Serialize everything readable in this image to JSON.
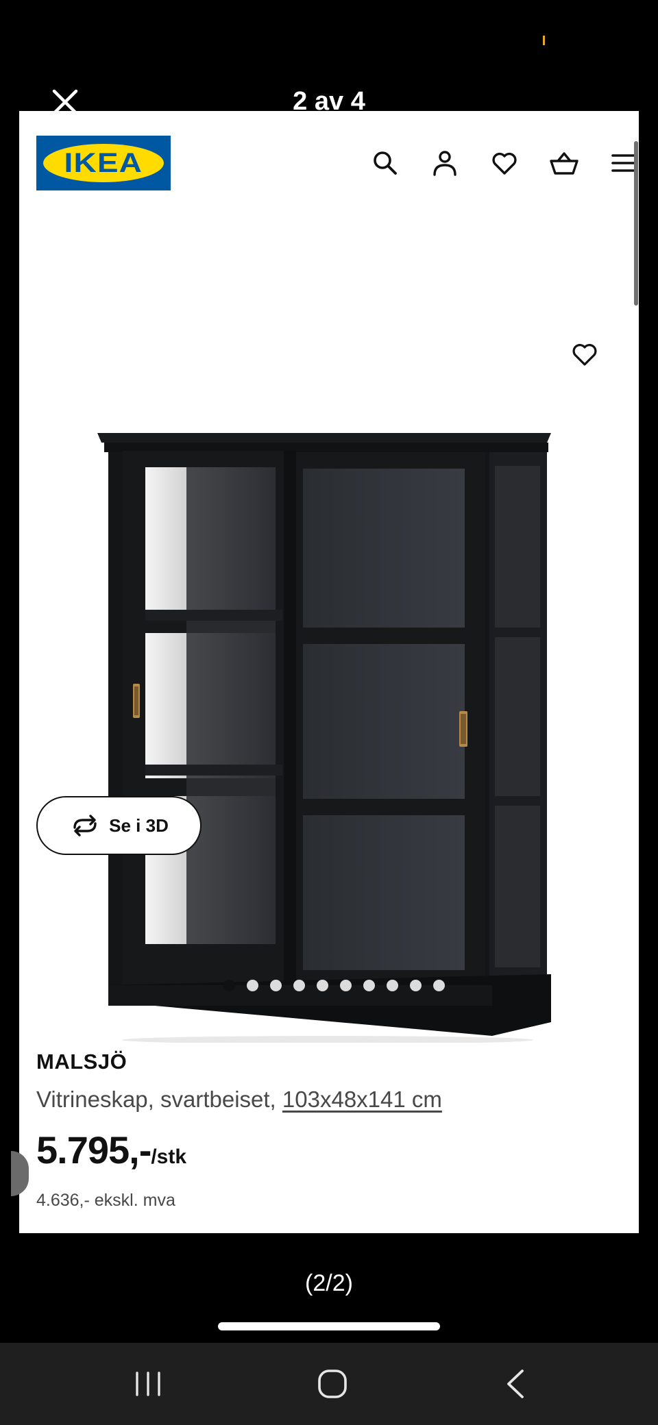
{
  "viewer": {
    "counter": "2 av 4",
    "page_counter": "(2/2)"
  },
  "header": {
    "logo_text": "IKEA",
    "icons": [
      "search-icon",
      "account-icon",
      "heart-icon",
      "basket-icon",
      "menu-icon"
    ]
  },
  "gallery": {
    "see_3d_label": "Se i 3D",
    "image_count": 10,
    "active_index": 0
  },
  "product": {
    "name": "MALSJÖ",
    "description": "Vitrineskap, svartbeiset,",
    "dimensions": "103x48x141 cm",
    "price": "5.795,-",
    "price_unit": "/stk",
    "price_ex_vat": "4.636,- ekskl. mva"
  },
  "colors": {
    "ikea_blue": "#0058a3",
    "ikea_yellow": "#ffdb00",
    "status_dot": "#e3a82a"
  },
  "system_nav": [
    "recent-apps-icon",
    "home-icon",
    "back-icon"
  ]
}
